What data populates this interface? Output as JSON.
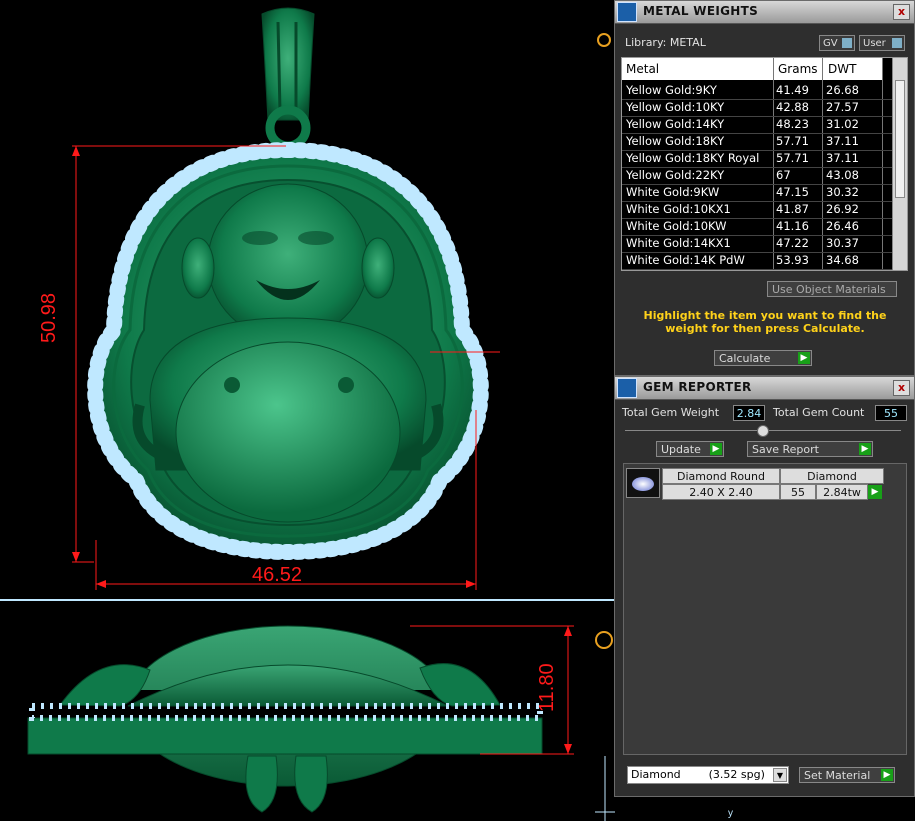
{
  "viewport": {
    "front_width_dim": "46.52",
    "front_height_dim": "50.98",
    "side_height_dim": "11.80",
    "axis_label": "y",
    "dim_color": "#ff1a1a",
    "model_color": "#0f7a4a",
    "gem_color": "#bfe8ff"
  },
  "metal": {
    "title": "METAL WEIGHTS",
    "close": "x",
    "library": "Library: METAL",
    "gv": "GV",
    "user": "User",
    "columns": [
      "Metal",
      "Grams",
      "DWT"
    ],
    "rows": [
      {
        "metal": "Yellow Gold:9KY",
        "grams": "41.49",
        "dwt": "26.68"
      },
      {
        "metal": "Yellow Gold:10KY",
        "grams": "42.88",
        "dwt": "27.57"
      },
      {
        "metal": "Yellow Gold:14KY",
        "grams": "48.23",
        "dwt": "31.02"
      },
      {
        "metal": "Yellow Gold:18KY",
        "grams": "57.71",
        "dwt": "37.11"
      },
      {
        "metal": "Yellow Gold:18KY Royal",
        "grams": "57.71",
        "dwt": "37.11"
      },
      {
        "metal": "Yellow Gold:22KY",
        "grams": "67",
        "dwt": "43.08"
      },
      {
        "metal": "White Gold:9KW",
        "grams": "47.15",
        "dwt": "30.32"
      },
      {
        "metal": "White Gold:10KX1",
        "grams": "41.87",
        "dwt": "26.92"
      },
      {
        "metal": "White Gold:10KW",
        "grams": "41.16",
        "dwt": "26.46"
      },
      {
        "metal": "White Gold:14KX1",
        "grams": "47.22",
        "dwt": "30.37"
      },
      {
        "metal": "White Gold:14K PdW",
        "grams": "53.93",
        "dwt": "34.68"
      }
    ],
    "use_object_materials": "Use Object Materials",
    "highlight_text": "Highlight the item you want to find the weight for then press Calculate.",
    "calculate": "Calculate"
  },
  "gem": {
    "title": "GEM REPORTER",
    "close": "x",
    "total_weight_label": "Total Gem Weight",
    "total_weight_value": "2.84",
    "total_count_label": "Total Gem Count",
    "total_count_value": "55",
    "update": "Update",
    "save_report": "Save Report",
    "item": {
      "shape": "Diamond Round",
      "material": "Diamond",
      "size": "2.40 X 2.40",
      "count": "55",
      "weight": "2.84tw"
    },
    "material_select": "Diamond        (3.52 spg)",
    "set_material": "Set Material"
  }
}
